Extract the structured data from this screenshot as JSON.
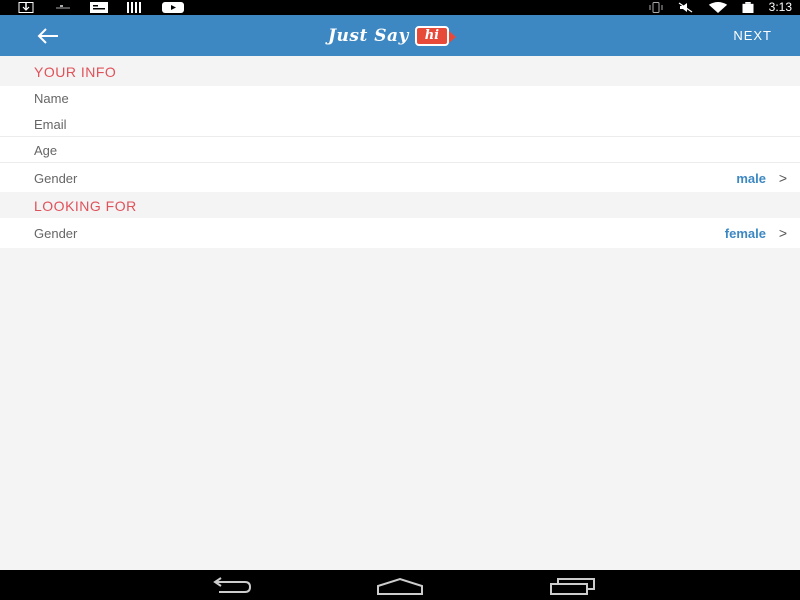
{
  "status_bar": {
    "time": "3:13",
    "left_icons": [
      "download-icon",
      "usb-icon",
      "message-icon",
      "barcode-icon",
      "youtube-icon"
    ],
    "right_icons": [
      "vibrate-icon",
      "mute-icon",
      "wifi-icon",
      "battery-icon"
    ]
  },
  "app_bar": {
    "logo_text": "Just Say",
    "logo_badge": "hi",
    "next_label": "NEXT"
  },
  "your_info": {
    "title": "YOUR INFO",
    "name_label": "Name",
    "email_label": "Email",
    "age_label": "Age",
    "gender_label": "Gender",
    "gender_value": "male"
  },
  "looking_for": {
    "title": "LOOKING FOR",
    "gender_label": "Gender",
    "gender_value": "female"
  },
  "colors": {
    "app_bar": "#3d88c3",
    "section_title": "#e0525a",
    "value_text": "#3d88c3",
    "logo_badge": "#e84a3a"
  }
}
